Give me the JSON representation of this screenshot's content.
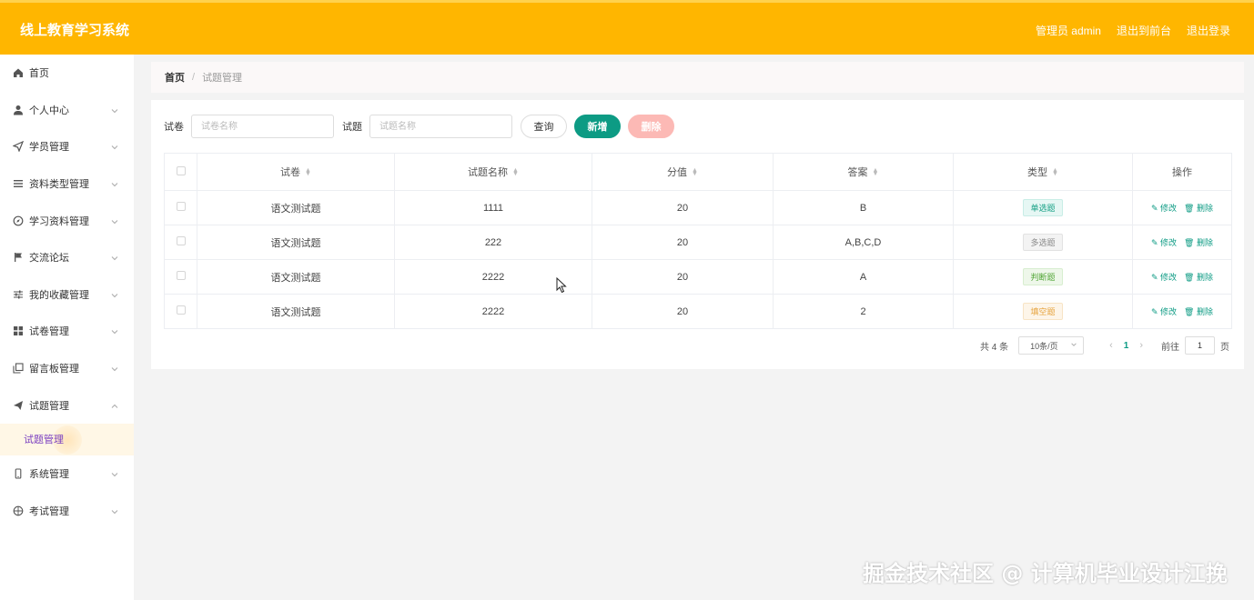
{
  "app": {
    "title": "线上教育学习系统"
  },
  "top_links": [
    "管理员 admin",
    "退出到前台",
    "退出登录"
  ],
  "sidebar": {
    "items": [
      {
        "label": "首页",
        "icon": "home-icon"
      },
      {
        "label": "个人中心",
        "icon": "user-icon"
      },
      {
        "label": "学员管理",
        "icon": "send-icon"
      },
      {
        "label": "资料类型管理",
        "icon": "list-icon"
      },
      {
        "label": "学习资料管理",
        "icon": "compass-icon"
      },
      {
        "label": "交流论坛",
        "icon": "flag-icon"
      },
      {
        "label": "我的收藏管理",
        "icon": "sliders-icon"
      },
      {
        "label": "试卷管理",
        "icon": "grid-icon"
      },
      {
        "label": "留言板管理",
        "icon": "copy-icon"
      },
      {
        "label": "试题管理",
        "icon": "paper-plane-icon"
      },
      {
        "label": "系统管理",
        "icon": "phone-icon"
      },
      {
        "label": "考试管理",
        "icon": "target-icon"
      }
    ],
    "submenu": {
      "label": "试题管理"
    }
  },
  "breadcrumb": {
    "home": "首页",
    "sep": "/",
    "current": "试题管理"
  },
  "filters": {
    "paper_label": "试卷",
    "paper_placeholder": "试卷名称",
    "question_label": "试题",
    "question_placeholder": "试题名称",
    "query_label": "查询",
    "add_label": "新增",
    "delete_label": "删除"
  },
  "table": {
    "headers": [
      "试卷",
      "试题名称",
      "分值",
      "答案",
      "类型",
      "操作"
    ],
    "rows": [
      {
        "paper": "语文测试题",
        "name": "1111",
        "score": "20",
        "answer": "B",
        "type": "单选题"
      },
      {
        "paper": "语文测试题",
        "name": "222",
        "score": "20",
        "answer": "A,B,C,D",
        "type": "多选题"
      },
      {
        "paper": "语文测试题",
        "name": "2222",
        "score": "20",
        "answer": "A",
        "type": "判断题"
      },
      {
        "paper": "语文测试题",
        "name": "2222",
        "score": "20",
        "answer": "2",
        "type": "填空题"
      }
    ],
    "edit_label": "修改",
    "delete_label": "删除"
  },
  "pagination": {
    "total": "共 4 条",
    "page_size": "10条/页",
    "current": "1",
    "goto_label": "前往",
    "goto_value": "1",
    "page_suffix": "页"
  },
  "watermark": "掘金技术社区 @ 计算机毕业设计江挽",
  "colors": {
    "header": "#ffb600",
    "primary": "#0d9b84",
    "danger_light": "#fcb9b5"
  }
}
